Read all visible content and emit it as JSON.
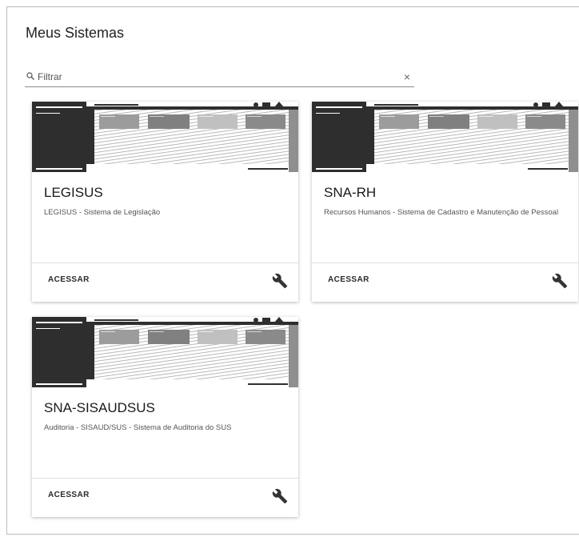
{
  "page": {
    "title": "Meus Sistemas"
  },
  "filter": {
    "placeholder": "Filtrar",
    "value": ""
  },
  "icons": {
    "search": "search-icon",
    "clear": "close-icon",
    "settings": "wrench-icon"
  },
  "cards": [
    {
      "title": "LEGISUS",
      "description": "LEGISUS - Sistema de Legislação",
      "action_label": "ACESSAR"
    },
    {
      "title": "SNA-RH",
      "description": "Recursos Humanos - Sistema de Cadastro e Manutenção de Pessoal",
      "action_label": "ACESSAR"
    },
    {
      "title": "SNA-SISAUDSUS",
      "description": "Auditoria - SISAUD/SUS - Sistema de Auditoria do SUS",
      "action_label": "ACESSAR"
    }
  ],
  "colors": {
    "thumb_dark": "#2e2e2e",
    "thumb_grey": "#8f8f8f"
  }
}
